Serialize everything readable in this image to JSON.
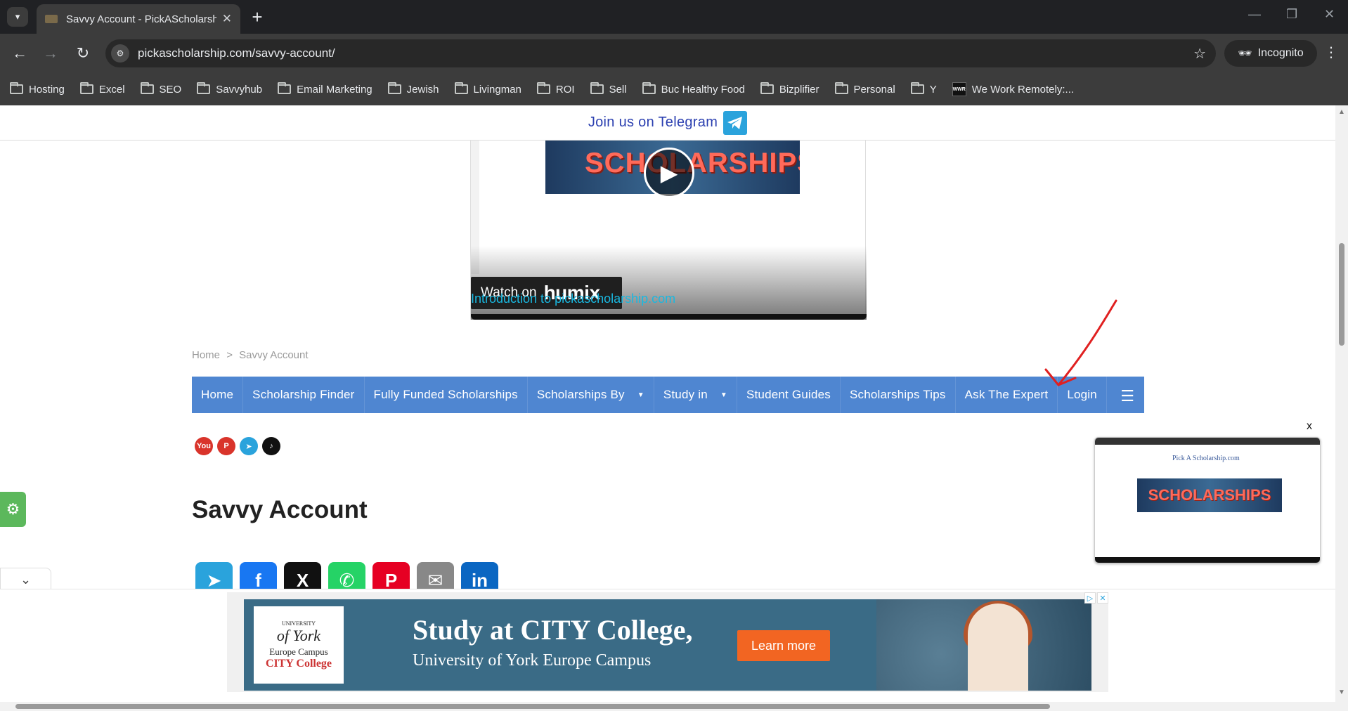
{
  "browser": {
    "tab_title": "Savvy Account - PickAScholarsh",
    "url": "pickascholarship.com/savvy-account/",
    "incognito_label": "Incognito",
    "bookmarks": [
      {
        "label": "Hosting",
        "icon": "folder-icon"
      },
      {
        "label": "Excel",
        "icon": "folder-icon"
      },
      {
        "label": "SEO",
        "icon": "folder-icon"
      },
      {
        "label": "Savvyhub",
        "icon": "folder-icon"
      },
      {
        "label": "Email Marketing",
        "icon": "folder-icon"
      },
      {
        "label": "Jewish",
        "icon": "folder-icon"
      },
      {
        "label": "Livingman",
        "icon": "folder-icon"
      },
      {
        "label": "ROI",
        "icon": "folder-icon"
      },
      {
        "label": "Sell",
        "icon": "folder-icon"
      },
      {
        "label": "Buc Healthy Food",
        "icon": "folder-icon"
      },
      {
        "label": "Bizplifier",
        "icon": "folder-icon"
      },
      {
        "label": "Personal",
        "icon": "folder-icon"
      },
      {
        "label": "Y",
        "icon": "folder-icon"
      },
      {
        "label": "We Work Remotely:...",
        "icon": "wwr-favicon-icon",
        "icon_text": "WWR"
      }
    ]
  },
  "page": {
    "telegram_text": "Join us on Telegram",
    "video": {
      "thumb_text": "SCHOLARSHIPS",
      "watch_on": "Watch on",
      "brand": "humix"
    },
    "intro_link": "Introduction to pickascholarship.com",
    "breadcrumb": {
      "home": "Home",
      "sep": ">",
      "current": "Savvy Account"
    },
    "nav": [
      {
        "label": "Home"
      },
      {
        "label": "Scholarship Finder"
      },
      {
        "label": "Fully Funded Scholarships"
      },
      {
        "label": "Scholarships By",
        "dropdown": true
      },
      {
        "label": "Study in",
        "dropdown": true
      },
      {
        "label": "Student Guides"
      },
      {
        "label": "Scholarships Tips"
      },
      {
        "label": "Ask The Expert"
      },
      {
        "label": "Login"
      }
    ],
    "social": [
      {
        "name": "youtube",
        "text": "You",
        "color": "#d9342b"
      },
      {
        "name": "pinterest",
        "text": "P",
        "color": "#d9342b"
      },
      {
        "name": "telegram",
        "text": "➤",
        "color": "#2aa3dc"
      },
      {
        "name": "tiktok",
        "text": "♪",
        "color": "#111111"
      }
    ],
    "title": "Savvy Account",
    "share": [
      {
        "name": "telegram",
        "text": "➤",
        "color": "#2aa3dc"
      },
      {
        "name": "facebook",
        "text": "f",
        "color": "#1877f2"
      },
      {
        "name": "x",
        "text": "X",
        "color": "#111111"
      },
      {
        "name": "whatsapp",
        "text": "✆",
        "color": "#25d366"
      },
      {
        "name": "pinterest",
        "text": "P",
        "color": "#e60023"
      },
      {
        "name": "email",
        "text": "✉",
        "color": "#888888"
      },
      {
        "name": "linkedin",
        "text": "in",
        "color": "#0a66c2"
      }
    ],
    "mini_video": {
      "site_name": "Pick A Scholarship.com",
      "banner_text": "SCHOLARSHIPS",
      "close": "x"
    },
    "ad": {
      "logo_line1": "UNIVERSITY",
      "logo_line2": "of York",
      "logo_line3": "Europe Campus",
      "logo_line4": "CITY College",
      "headline": "Study at CITY College,",
      "subline": "University of York Europe Campus",
      "cta": "Learn more"
    },
    "accent_color": "#4f86d1",
    "link_color": "#19b8e0"
  }
}
